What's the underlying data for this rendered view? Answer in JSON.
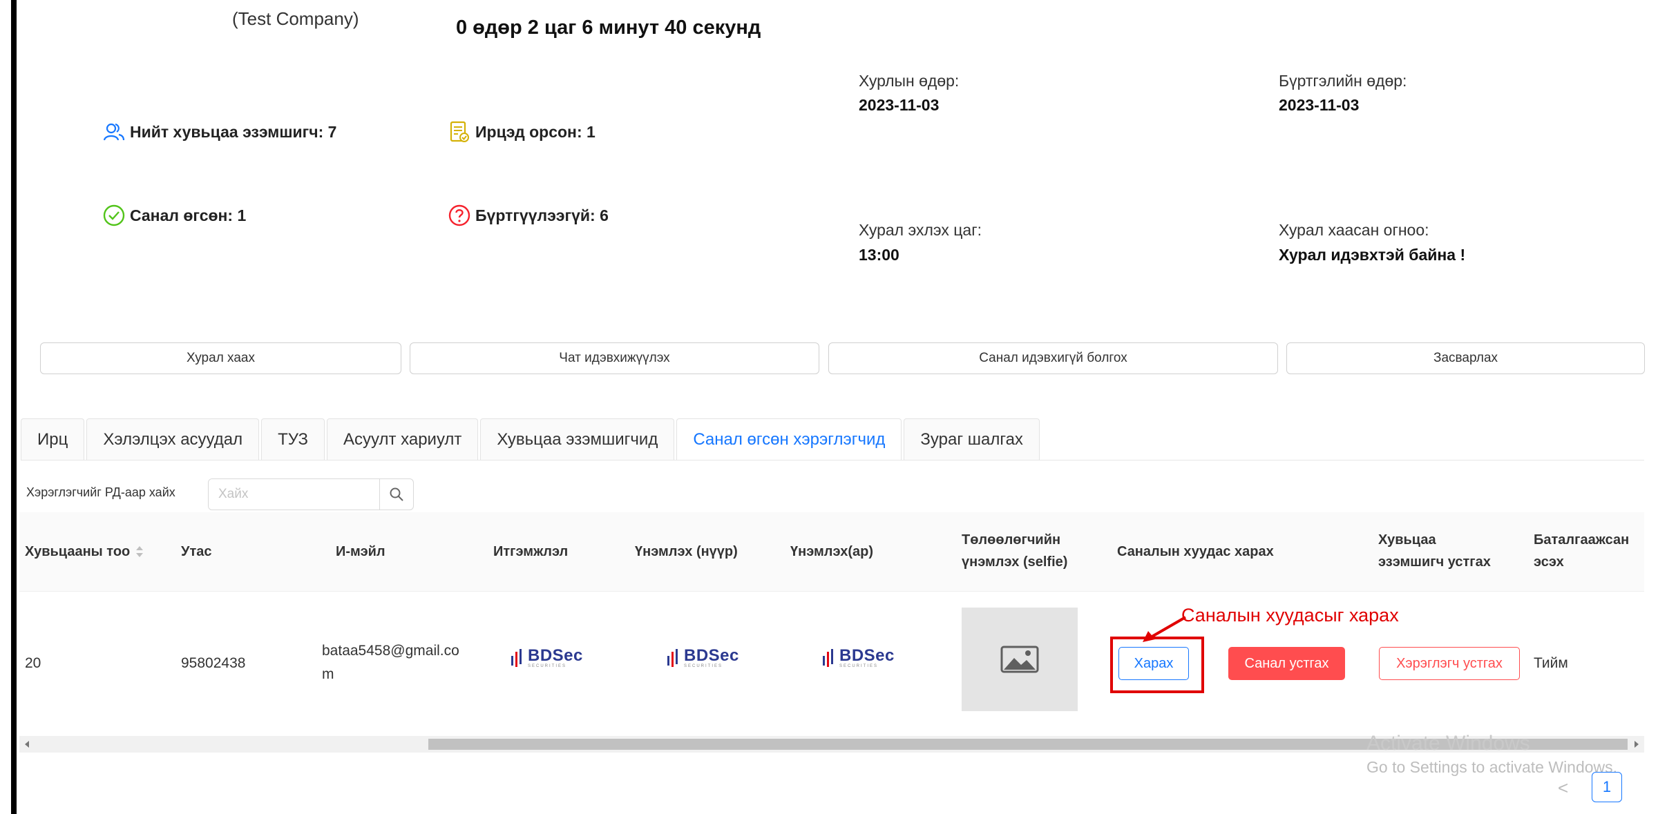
{
  "header": {
    "company": "(Test Company)",
    "countdown": "0 өдөр 2 цаг 6 минут 40 секунд"
  },
  "stats": {
    "total_holders": "Нийт хувьцаа эзэмшигч: 7",
    "attended": "Ирцэд орсон: 1",
    "voted": "Санал өгсөн: 1",
    "unregistered": "Бүртгүүлээгүй: 6"
  },
  "info": {
    "meeting_date_label": "Хурлын өдөр:",
    "meeting_date": "2023-11-03",
    "registration_date_label": "Бүртгэлийн өдөр:",
    "registration_date": "2023-11-03",
    "start_time_label": "Хурал эхлэх цаг:",
    "start_time": "13:00",
    "end_label": "Хурал хаасан огноо:",
    "end_value": "Хурал идэвхтэй байна !"
  },
  "actions": {
    "close_meeting": "Хурал хаах",
    "enable_chat": "Чат идэвхижүүлэх",
    "disable_voting": "Санал идэвхигүй болгох",
    "edit": "Засварлах"
  },
  "tabs": [
    {
      "label": "Ирц"
    },
    {
      "label": "Хэлэлцэх асуудал"
    },
    {
      "label": "ТУЗ"
    },
    {
      "label": "Асуулт хариулт"
    },
    {
      "label": "Хувьцаа эзэмшигчид"
    },
    {
      "label": "Санал өгсөн хэрэглэгчид"
    },
    {
      "label": "Зураг шалгах"
    }
  ],
  "active_tab": "Санал өгсөн хэрэглэгчид",
  "search": {
    "label": "Хэрэглэгчийг РД-аар хайх",
    "placeholder": "Хайх"
  },
  "table": {
    "columns": [
      "Хувьцааны тоо",
      "Утас",
      "И-мэйл",
      "Итгэмжлэл",
      "Үнэмлэх (нүүр)",
      "Үнэмлэх(ар)",
      "Төлөөлөгчийн үнэмлэх (selfie)",
      "Саналын хуудас харах",
      "Хувьцаа эзэмшигч устгах",
      "Баталгаажсан эсэх"
    ],
    "rows": [
      {
        "shares": "20",
        "phone": "95802438",
        "email": "bataa5458@gmail.com",
        "logo_text": "BDSec",
        "logo_sub": "SECURITIES",
        "view_button": "Харах",
        "remove_vote_button": "Санал устгах",
        "remove_user_button": "Хэрэглэгч устгах",
        "verified": "Тийм"
      }
    ]
  },
  "annotation": "Саналын хуудасыг харах",
  "watermark": {
    "line1": "Activate Windows",
    "line2": "Go to Settings to activate Windows."
  },
  "pagination": {
    "prev": "<",
    "current": "1"
  }
}
